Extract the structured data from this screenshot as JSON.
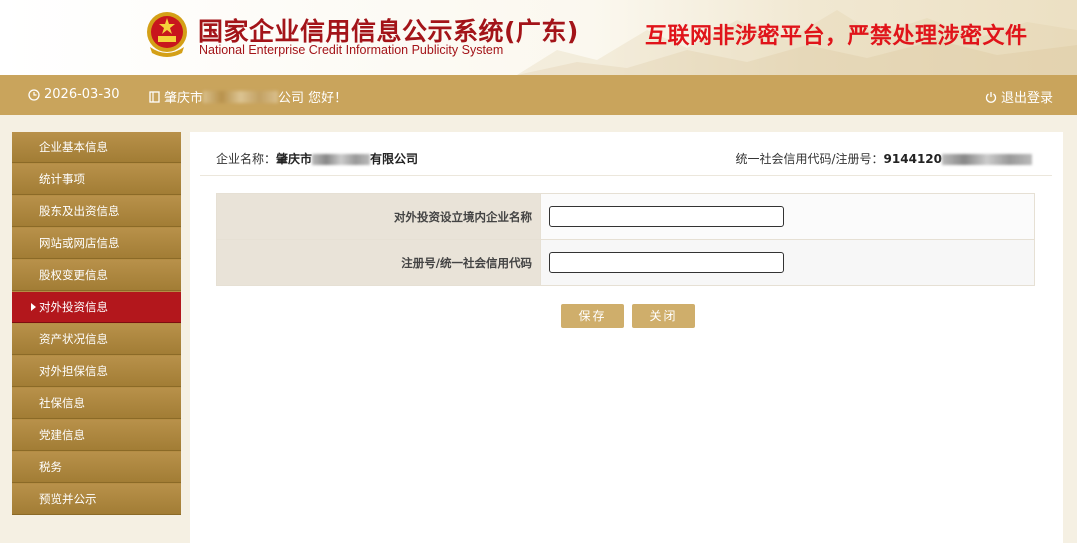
{
  "header": {
    "title": "国家企业信用信息公示系统(广东)",
    "subtitle": "National Enterprise Credit Information Publicity System",
    "warning": "互联网非涉密平台，严禁处理涉密文件"
  },
  "topbar": {
    "date": "2026-03-30",
    "user_prefix": "肇庆市",
    "user_suffix": "公司 您好！",
    "logout": "退出登录"
  },
  "sidebar": {
    "items": [
      {
        "label": "企业基本信息"
      },
      {
        "label": "统计事项"
      },
      {
        "label": "股东及出资信息"
      },
      {
        "label": "网站或网店信息"
      },
      {
        "label": "股权变更信息"
      },
      {
        "label": "对外投资信息"
      },
      {
        "label": "资产状况信息"
      },
      {
        "label": "对外担保信息"
      },
      {
        "label": "社保信息"
      },
      {
        "label": "党建信息"
      },
      {
        "label": "税务"
      },
      {
        "label": "预览并公示"
      }
    ],
    "active_index": 5
  },
  "company": {
    "name_label": "企业名称：",
    "name_prefix": "肇庆市",
    "name_suffix": "有限公司",
    "code_label": "统一社会信用代码/注册号：",
    "code_prefix": "9144120"
  },
  "form": {
    "field1_label": "对外投资设立境内企业名称",
    "field1_value": "",
    "field2_label": "注册号/统一社会信用代码",
    "field2_value": ""
  },
  "buttons": {
    "save": "保存",
    "close": "关闭"
  },
  "colors": {
    "gold": "#c9a45c",
    "active_red": "#b3171c",
    "title_red": "#a31419",
    "warning_red": "#e0141a"
  }
}
